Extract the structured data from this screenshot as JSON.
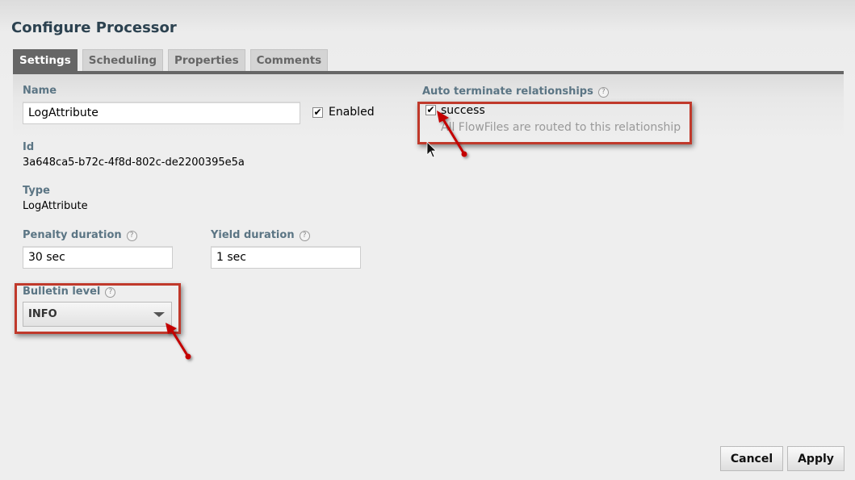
{
  "dialog": {
    "title": "Configure Processor",
    "tabs": [
      {
        "label": "Settings",
        "active": true
      },
      {
        "label": "Scheduling",
        "active": false
      },
      {
        "label": "Properties",
        "active": false
      },
      {
        "label": "Comments",
        "active": false
      }
    ]
  },
  "settings": {
    "name_label": "Name",
    "name_value": "LogAttribute",
    "enabled_label": "Enabled",
    "enabled_checked": true,
    "id_label": "Id",
    "id_value": "3a648ca5-b72c-4f8d-802c-de2200395e5a",
    "type_label": "Type",
    "type_value": "LogAttribute",
    "penalty_label": "Penalty duration",
    "penalty_value": "30 sec",
    "yield_label": "Yield duration",
    "yield_value": "1 sec",
    "bulletin_label": "Bulletin level",
    "bulletin_value": "INFO",
    "help_glyph": "?"
  },
  "auto_terminate": {
    "label": "Auto terminate relationships",
    "relationships": [
      {
        "name": "success",
        "checked": true,
        "description": "All FlowFiles are routed to this relationship"
      }
    ]
  },
  "buttons": {
    "cancel": "Cancel",
    "apply": "Apply"
  },
  "check_glyph": "✔",
  "annotation_color": "#c0392b"
}
